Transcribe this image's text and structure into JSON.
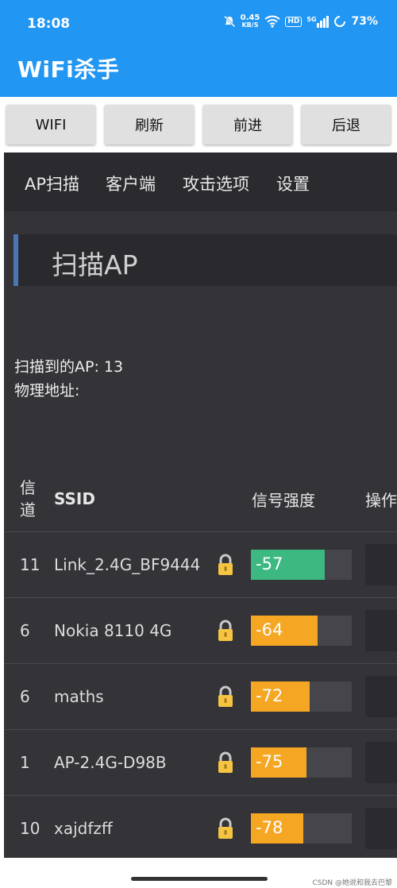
{
  "status": {
    "time": "18:08",
    "speed_value": "0.45",
    "speed_unit": "KB/S",
    "hd_label": "HD",
    "network_label": "5G",
    "battery": "73%"
  },
  "app": {
    "title": "WiFi杀手"
  },
  "buttons": [
    "WIFI",
    "刷新",
    "前进",
    "后退"
  ],
  "tabs": [
    "AP扫描",
    "客户端",
    "攻击选项",
    "设置"
  ],
  "section": {
    "title": "扫描AP"
  },
  "info": {
    "ap_count": "扫描到的AP: 13",
    "mac_label": "物理地址:"
  },
  "table": {
    "headers": {
      "channel": "信\n道",
      "ssid": "SSID",
      "signal": "信号强度",
      "action": "操作"
    },
    "rows": [
      {
        "channel": "11",
        "ssid": "Link_2.4G_BF9444",
        "signal": "-57",
        "signal_fraction": 0.73,
        "color": "#3db881"
      },
      {
        "channel": "6",
        "ssid": "Nokia 8110 4G",
        "signal": "-64",
        "signal_fraction": 0.66,
        "color": "#f5a623"
      },
      {
        "channel": "6",
        "ssid": "maths",
        "signal": "-72",
        "signal_fraction": 0.58,
        "color": "#f5a623"
      },
      {
        "channel": "1",
        "ssid": "AP-2.4G-D98B",
        "signal": "-75",
        "signal_fraction": 0.55,
        "color": "#f5a623"
      },
      {
        "channel": "10",
        "ssid": "xajdfzff",
        "signal": "-78",
        "signal_fraction": 0.52,
        "color": "#f5a623"
      }
    ]
  },
  "watermark": "CSDN @她说和我去巴黎",
  "icons": [
    "mute-icon",
    "wifi-icon",
    "hd-icon",
    "signal-icon",
    "battery-icon",
    "lock-icon"
  ]
}
